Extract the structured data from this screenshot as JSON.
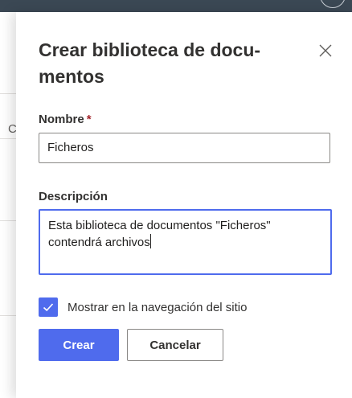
{
  "panel": {
    "title": "Crear biblioteca de docu-mentos",
    "close_icon": "close-icon"
  },
  "form": {
    "name_label": "Nombre",
    "required_mark": "*",
    "name_value": "Ficheros",
    "description_label": "Descripción",
    "description_value": "Esta biblioteca de documentos \"Ficheros\" contendrá archivos",
    "show_in_nav_label": "Mostrar en la navegación del sitio",
    "show_in_nav_checked": true
  },
  "actions": {
    "create_label": "Crear",
    "cancel_label": "Cancelar"
  },
  "background": {
    "partial_letter": "C"
  },
  "colors": {
    "accent": "#4f6bed",
    "topbar": "#3b4854",
    "required": "#a4262c"
  }
}
